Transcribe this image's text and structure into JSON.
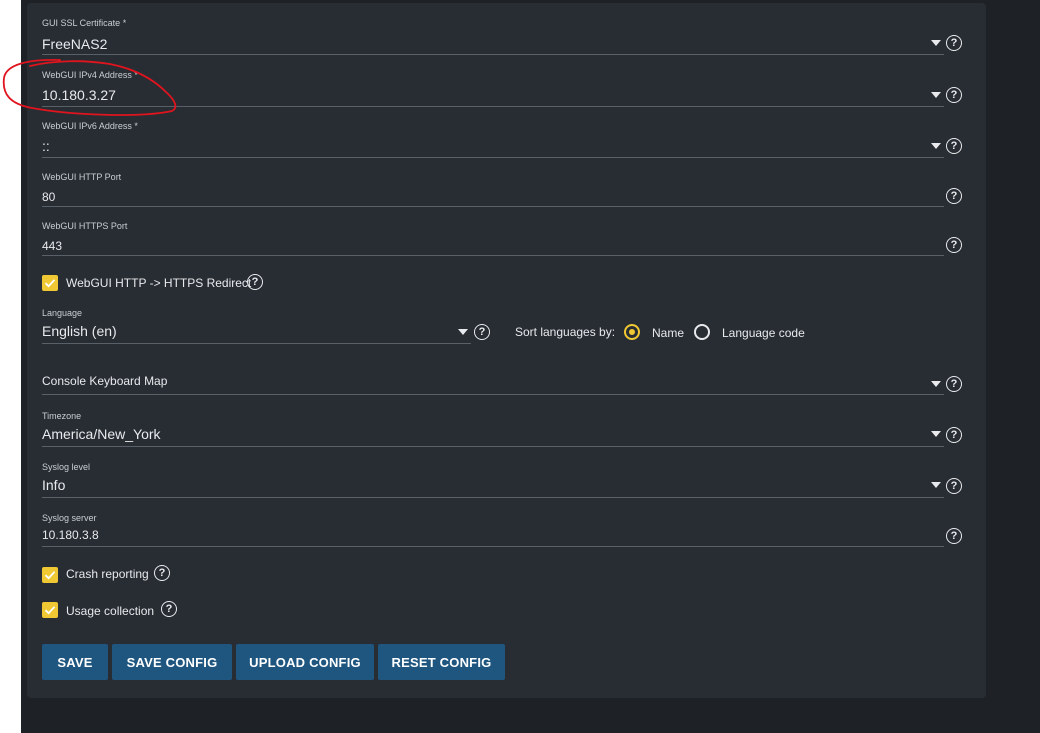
{
  "form": {
    "ssl_certificate": {
      "label": "GUI SSL Certificate *",
      "value": "FreeNAS2"
    },
    "ipv4": {
      "label": "WebGUI IPv4 Address *",
      "value": "10.180.3.27"
    },
    "ipv6": {
      "label": "WebGUI IPv6 Address *",
      "value": "::"
    },
    "http_port": {
      "label": "WebGUI HTTP Port",
      "value": "80"
    },
    "https_port": {
      "label": "WebGUI HTTPS Port",
      "value": "443"
    },
    "https_redirect": {
      "label": "WebGUI HTTP -> HTTPS Redirect",
      "checked": true
    },
    "language": {
      "label": "Language",
      "value": "English (en)"
    },
    "sort_languages": {
      "label": "Sort languages by:",
      "options": [
        "Name",
        "Language code"
      ],
      "selected": "Name"
    },
    "keyboard_map": {
      "placeholder": "Console Keyboard Map",
      "value": ""
    },
    "timezone": {
      "label": "Timezone",
      "value": "America/New_York"
    },
    "syslog_level": {
      "label": "Syslog level",
      "value": "Info"
    },
    "syslog_server": {
      "label": "Syslog server",
      "value": "10.180.3.8"
    },
    "crash_reporting": {
      "label": "Crash reporting",
      "checked": true
    },
    "usage_collection": {
      "label": "Usage collection",
      "checked": true
    }
  },
  "help_glyph": "?",
  "buttons": {
    "save": "SAVE",
    "save_config": "SAVE CONFIG",
    "upload_config": "UPLOAD CONFIG",
    "reset_config": "RESET CONFIG"
  },
  "colors": {
    "card_bg": "#282d33",
    "accent": "#f0c833",
    "button_bg": "#1e5680",
    "annotation": "#e0141e"
  },
  "icons": {
    "help": "help-circle-icon",
    "dropdown": "caret-down-icon",
    "check": "check-icon"
  }
}
